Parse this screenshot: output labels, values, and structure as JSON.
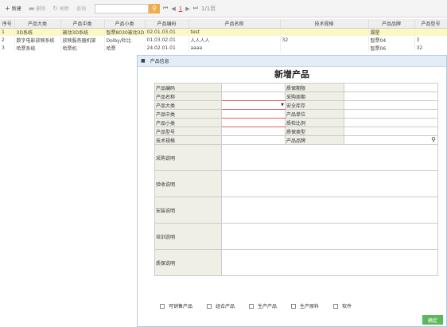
{
  "toolbar": {
    "new_label": "新建",
    "delete_label": "删除",
    "refresh_label": "刷新",
    "query_label": "查询",
    "search_placeholder": "",
    "pager_page": "1",
    "pager_total": "1/1页"
  },
  "grid": {
    "headers": [
      "序号",
      "产品大类",
      "产品中类",
      "产品小类",
      "产品编码",
      "产品名称",
      "技术规格",
      "产品品牌",
      "产品型号"
    ],
    "rows": [
      [
        "1",
        "3D系统",
        "被动3D系统",
        "智票8030被动3D系",
        "02.01.03.01",
        "test",
        "",
        "漏星",
        ""
      ],
      [
        "2",
        "数字电影放映系统",
        "放映服务器机架",
        "Dolby/杜比",
        "01.03.02.01",
        "人人人人",
        "32",
        "智票04",
        "3"
      ],
      [
        "3",
        "哈票系统",
        "哈票机",
        "哈票",
        "24.02.01.01",
        "aaaa",
        "",
        "智票06",
        "32"
      ]
    ]
  },
  "modal": {
    "header": "产品信息",
    "title": "新增产品",
    "fields": {
      "code": "产品编码",
      "warranty": "质保期限",
      "name": "产品名称",
      "purchase_cycle": "采购周期",
      "category": "产品大类",
      "safety_stock": "安全库存",
      "mid_category": "产品中类",
      "unit": "产品单位",
      "sub_category": "产品小类",
      "inspection_ratio": "质检比例",
      "model": "产品型号",
      "warranty_type": "质保类型",
      "spec": "技术规格",
      "brand": "产品品牌",
      "purchase_note": "采购说明",
      "acceptance_note": "验收说明",
      "install_note": "安装说明",
      "training_note": "培训说明",
      "warranty_note": "质保说明"
    },
    "checks": [
      "可销售产品",
      "组合产品",
      "生产产品",
      "生产原料",
      "软件"
    ],
    "ok_label": "确定"
  }
}
